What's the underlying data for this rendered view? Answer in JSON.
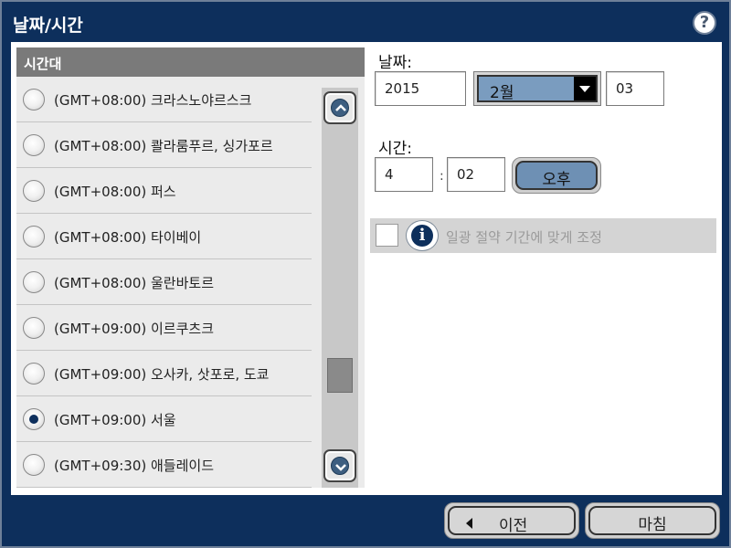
{
  "window": {
    "title": "날짜/시간",
    "help_symbol": "?"
  },
  "timezone": {
    "header": "시간대",
    "items": [
      {
        "label": "(GMT+08:00) 크라스노야르스크",
        "selected": false
      },
      {
        "label": "(GMT+08:00) 콸라룸푸르, 싱가포르",
        "selected": false
      },
      {
        "label": "(GMT+08:00) 퍼스",
        "selected": false
      },
      {
        "label": "(GMT+08:00) 타이베이",
        "selected": false
      },
      {
        "label": "(GMT+08:00) 울란바토르",
        "selected": false
      },
      {
        "label": "(GMT+09:00) 이르쿠츠크",
        "selected": false
      },
      {
        "label": "(GMT+09:00) 오사카, 삿포로, 도쿄",
        "selected": false
      },
      {
        "label": "(GMT+09:00) 서울",
        "selected": true
      },
      {
        "label": "(GMT+09:30) 애들레이드",
        "selected": false
      }
    ]
  },
  "date": {
    "label": "날짜:",
    "year": "2015",
    "month": "2월",
    "day": "03"
  },
  "time": {
    "label": "시간:",
    "hour": "4",
    "minute": "02",
    "separator": ":",
    "ampm": "오후"
  },
  "dst": {
    "label": "일광 절약 기간에 맞게 조정",
    "checked": false,
    "info_symbol": "i"
  },
  "footer": {
    "prev_label": "이전",
    "finish_label": "마침"
  },
  "colors": {
    "frame": "#0d2f5c",
    "accent": "#7a9cbf",
    "panel": "#ebebeb"
  }
}
